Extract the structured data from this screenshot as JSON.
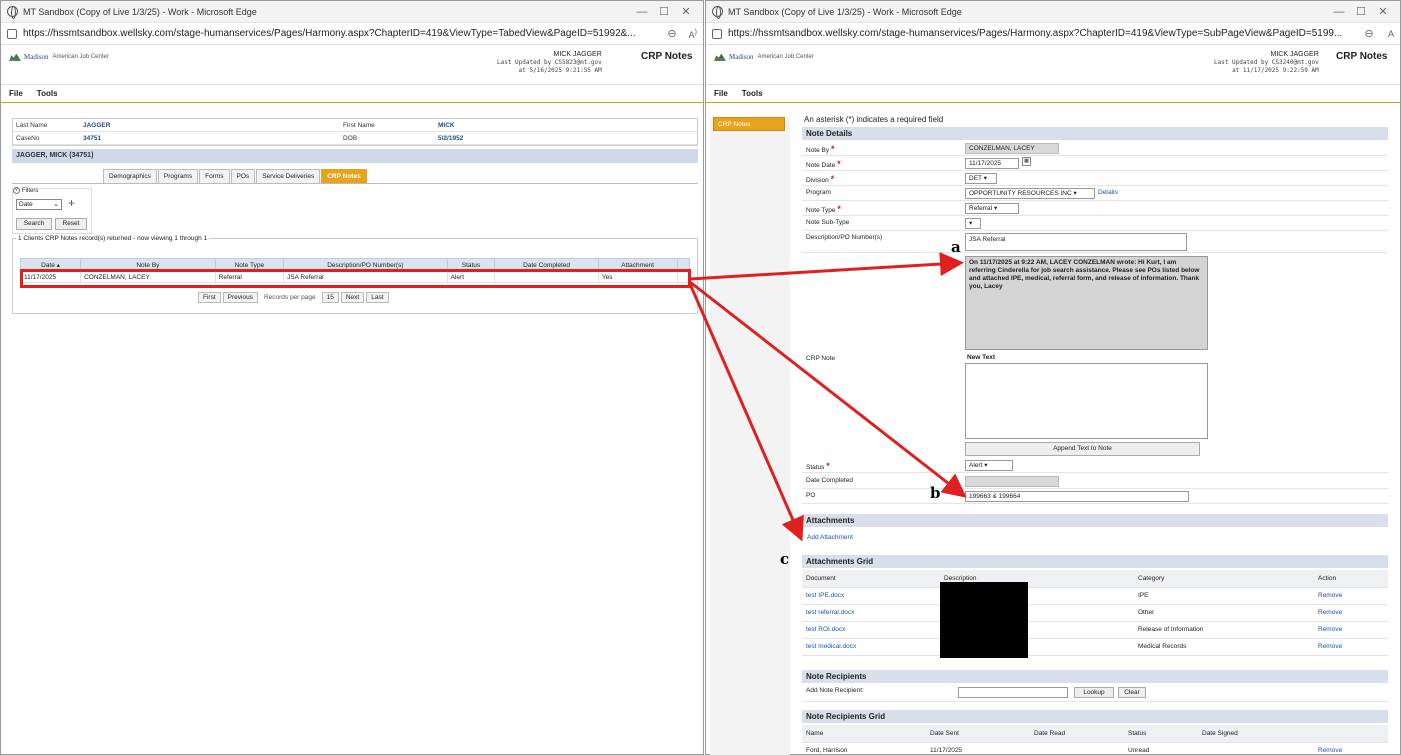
{
  "left_window": {
    "title": "MT Sandbox (Copy of Live 1/3/25) - Work - Microsoft Edge",
    "url": "https://hssmtsandbox.wellsky.com/stage-humanservices/Pages/Harmony.aspx?ChapterID=419&ViewType=TabedView&PageID=51992&...",
    "logo_text": "Madison",
    "logo_sub": "American Job Center",
    "user_name": "MICK JAGGER",
    "last_updated": "Last Updated by CS5823@mt.gov",
    "last_updated_at": "at 5/16/2025 9:21:55 AM",
    "page_title": "CRP Notes",
    "menu": [
      "File",
      "Tools"
    ],
    "client": {
      "last_name_label": "Last Name",
      "last_name": "JAGGER",
      "first_name_label": "First Name",
      "first_name": "MICK",
      "caseno_label": "CaseNo",
      "caseno": "34751",
      "dob_label": "DOB",
      "dob": "5/2/1952"
    },
    "case_header": "JAGGER, MICK (34751)",
    "tabs": [
      "Demographics",
      "Programs",
      "Forms",
      "POs",
      "Service Deliveries",
      "CRP Notes"
    ],
    "filters_label": "Filters",
    "filter_select": "Date",
    "search_button": "Search",
    "reset_button": "Reset",
    "results_caption": "1 Clients CRP Notes record(s) returned - now viewing 1 through 1",
    "grid_headers": [
      "Date",
      "Note By",
      "Note Type",
      "Description/PO Number(s)",
      "Status",
      "Date Completed",
      "Attachment"
    ],
    "grid_rows": [
      [
        "11/17/2025",
        "CONZELMAN, LACEY",
        "Referral",
        "JSA Referral",
        "Alert",
        "",
        "Yes"
      ]
    ],
    "pager": {
      "first": "First",
      "previous": "Previous",
      "per_page_label": "Records per page",
      "per_page": "15",
      "next": "Next",
      "last": "Last"
    }
  },
  "right_window": {
    "title": "MT Sandbox (Copy of Live 1/3/25) - Work - Microsoft Edge",
    "url": "https://hssmtsandbox.wellsky.com/stage-humanservices/Pages/Harmony.aspx?ChapterID=419&ViewType=SubPageView&PageID=5199...",
    "logo_text": "Madison",
    "logo_sub": "American Job Center",
    "user_name": "MICK JAGGER",
    "last_updated": "Last Updated by CS3240@mt.gov",
    "last_updated_at": "at 11/17/2025 9:22:59 AM",
    "page_title": "CRP Notes",
    "menu": [
      "File",
      "Tools"
    ],
    "side_nav": "CRP Notes",
    "required_notice": "An asterisk (*) indicates a required field",
    "note_details": {
      "header": "Note Details",
      "note_by_label": "Note By",
      "note_by": "CONZELMAN, LACEY",
      "note_date_label": "Note Date",
      "note_date": "11/17/2025",
      "division_label": "Division",
      "division": "DET",
      "program_label": "Program",
      "program": "OPPORTUNITY RESOURCES INC",
      "program_link": "Details",
      "note_type_label": "Note Type",
      "note_type": "Referral",
      "note_subtype_label": "Note Sub-Type",
      "note_subtype": "",
      "description_label": "Description/PO Number(s)",
      "description": "JSA Referral",
      "history_text": "On 11/17/2025 at 9:22 AM,  LACEY CONZELMAN wrote: Hi Kurt, I am referring Cinderella for job search assistance. Please see POs listed below and attached IPE, medical, referral form, and release of information. Thank you, Lacey",
      "crp_note_label": "CRP Note",
      "new_text_label": "New Text",
      "new_text": "",
      "append_button": "Append Text to Note",
      "status_label": "Status",
      "status": "Alert",
      "date_completed_label": "Date Completed",
      "date_completed": "",
      "po_label": "PO",
      "po": "199663 & 199664"
    },
    "attachments": {
      "header": "Attachments",
      "add_link": "Add Attachment"
    },
    "attachments_grid": {
      "header": "Attachments Grid",
      "columns": [
        "Document",
        "Description",
        "Category",
        "Action"
      ],
      "rows": [
        {
          "document": "test IPE.docx",
          "category": "IPE",
          "action": "Remove"
        },
        {
          "document": "test referral.docx",
          "category": "Other",
          "action": "Remove"
        },
        {
          "document": "test ROI.docx",
          "category": "Release of Information",
          "action": "Remove"
        },
        {
          "document": "test medical.docx",
          "category": "Medical Records",
          "action": "Remove"
        }
      ]
    },
    "note_recipients": {
      "header": "Note Recipients",
      "add_label": "Add Note Recipient:",
      "lookup_button": "Lookup",
      "clear_button": "Clear"
    },
    "recipients_grid": {
      "header": "Note Recipients Grid",
      "columns": [
        "Name",
        "Date Sent",
        "Date Read",
        "Status",
        "Date Signed"
      ],
      "rows": [
        {
          "name": "Ford, Harrison",
          "date_sent": "11/17/2025",
          "date_read": "",
          "status": "Unread",
          "date_signed": "",
          "action": "Remove"
        }
      ]
    }
  },
  "annotations": {
    "a": "a",
    "b": "b",
    "c": "c",
    "arrow_color": "#e02020"
  },
  "colors": {
    "accent": "#e7a31e",
    "header_bg": "#d8deea",
    "link": "#1f4fb3"
  }
}
